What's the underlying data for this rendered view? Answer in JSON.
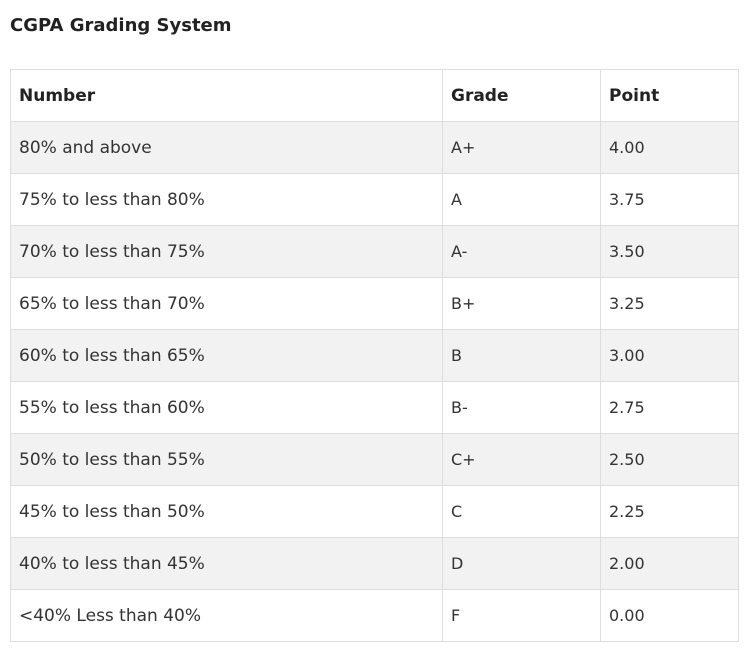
{
  "page": {
    "title": "CGPA Grading System"
  },
  "table": {
    "headers": {
      "number": "Number",
      "grade": "Grade",
      "point": "Point"
    },
    "rows": [
      {
        "number": "80% and above",
        "grade": "A+",
        "point": "4.00"
      },
      {
        "number": "75% to less than 80%",
        "grade": "A",
        "point": "3.75"
      },
      {
        "number": "70% to less than 75%",
        "grade": "A-",
        "point": "3.50"
      },
      {
        "number": "65% to less than 70%",
        "grade": "B+",
        "point": "3.25"
      },
      {
        "number": "60% to less than 65%",
        "grade": "B",
        "point": "3.00"
      },
      {
        "number": "55% to less than 60%",
        "grade": "B-",
        "point": "2.75"
      },
      {
        "number": "50% to less than 55%",
        "grade": "C+",
        "point": "2.50"
      },
      {
        "number": "45% to less than 50%",
        "grade": "C",
        "point": "2.25"
      },
      {
        "number": "40% to less than 45%",
        "grade": "D",
        "point": "2.00"
      },
      {
        "number": "<40% Less than 40%",
        "grade": "F",
        "point": "0.00"
      }
    ]
  },
  "colors": {
    "text": "#222222",
    "border": "#dddddd",
    "row_stripe": "#f2f2f2",
    "background": "#ffffff"
  }
}
